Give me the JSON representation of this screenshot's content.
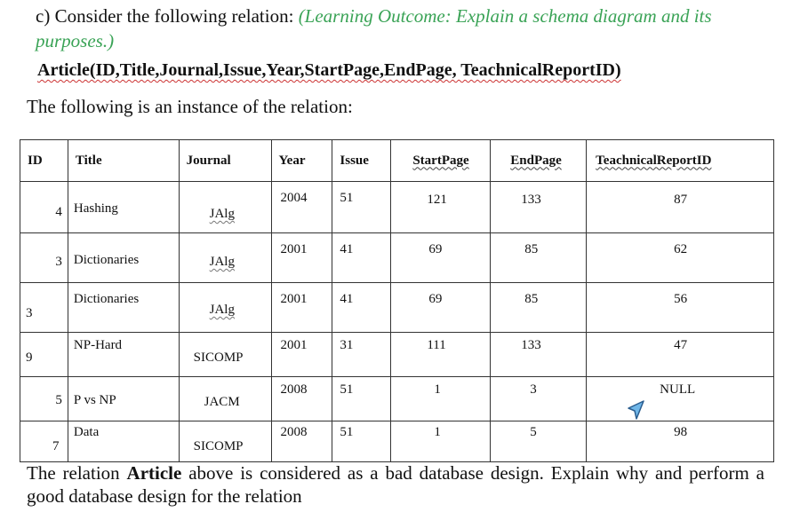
{
  "question": {
    "prefix": "c) Consider the following relation: ",
    "learning_outcome": "(Learning Outcome: Explain a schema diagram and its purposes.)"
  },
  "relation_schema": "Article(ID,Title,Journal,Issue,Year,StartPage,EndPage, TeachnicalReportID)",
  "intro": "The following is an instance of the relation:",
  "table": {
    "headers": [
      "ID",
      "Title",
      "Journal",
      "Year",
      "Issue",
      "StartPage",
      "EndPage",
      "TeachnicalReportID"
    ],
    "rows": [
      {
        "id": "4",
        "title": "Hashing",
        "journal": "JAlg",
        "year": "2004",
        "issue": "51",
        "start": "121",
        "end": "133",
        "report": "87"
      },
      {
        "id": "3",
        "title": "Dictionaries",
        "journal": "JAlg",
        "year": "2001",
        "issue": "41",
        "start": "69",
        "end": "85",
        "report": "62"
      },
      {
        "id": "3",
        "title": "Dictionaries",
        "journal": "JAlg",
        "year": "2001",
        "issue": "41",
        "start": "69",
        "end": "85",
        "report": "56"
      },
      {
        "id": "9",
        "title": "NP-Hard",
        "journal": "SICOMP",
        "year": "2001",
        "issue": "31",
        "start": "111",
        "end": "133",
        "report": "47"
      },
      {
        "id": "5",
        "title": "P vs NP",
        "journal": "JACM",
        "year": "2008",
        "issue": "51",
        "start": "1",
        "end": "3",
        "report": "NULL"
      },
      {
        "id": "7",
        "title": "Data",
        "journal": "SICOMP",
        "year": "2008",
        "issue": "51",
        "start": "1",
        "end": "5",
        "report": "98"
      }
    ]
  },
  "closing": {
    "part1": "The relation ",
    "bold": "Article",
    "part2": " above is considered as a bad database design. Explain why and perform a good database design for the relation"
  }
}
